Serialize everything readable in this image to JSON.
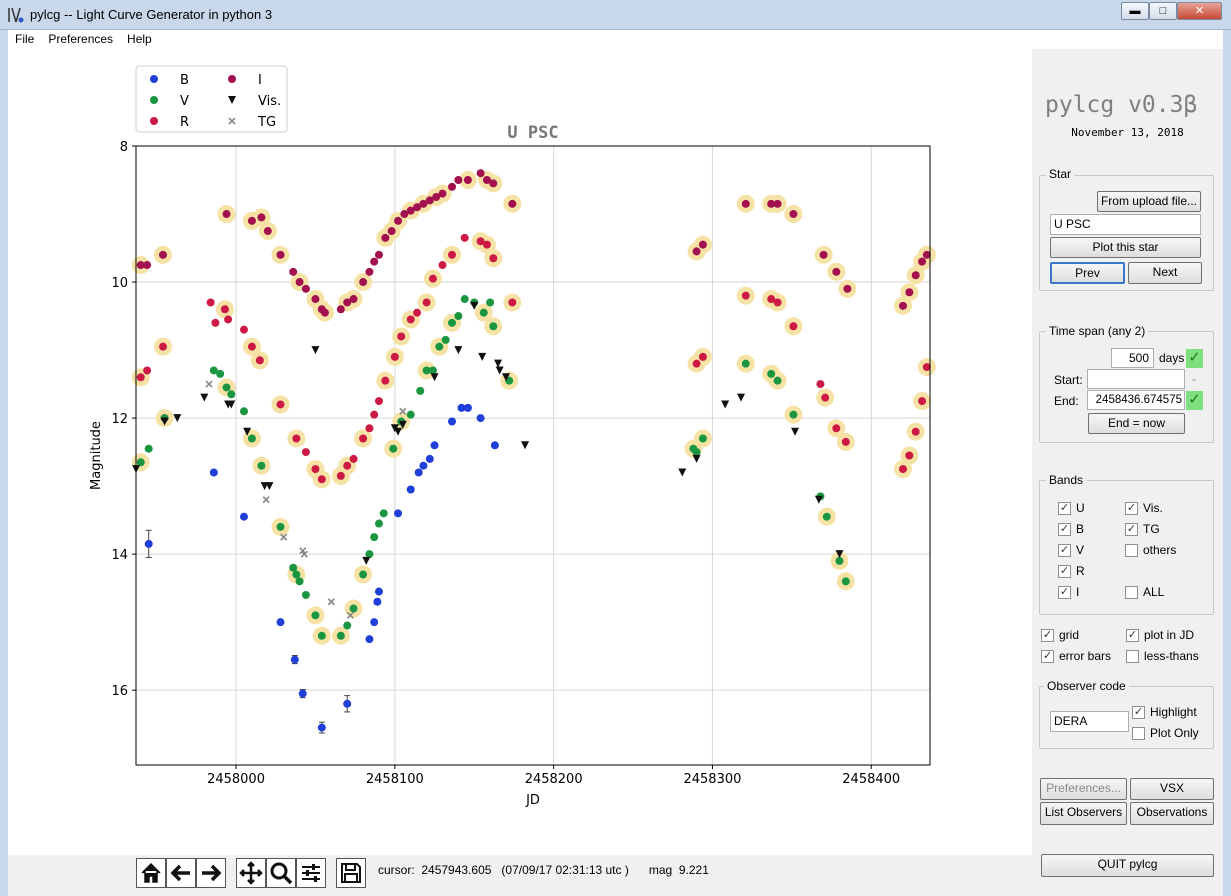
{
  "window": {
    "title": "pylcg  -- Light Curve Generator in python 3",
    "icon": "pylcg-app-icon",
    "minimize": "▬",
    "maximize": "□",
    "close": "✕"
  },
  "menu": [
    "File",
    "Preferences",
    "Help"
  ],
  "app": {
    "name": "pylcg v0.3β",
    "date": "November 13, 2018"
  },
  "star_panel": {
    "label": "Star",
    "upload_button": "From upload file...",
    "star_value": "U PSC",
    "plot_button": "Plot this star",
    "prev_button": "Prev",
    "next_button": "Next"
  },
  "timespan_panel": {
    "label": "Time span (any 2)",
    "days_value": "500",
    "days_label": "days",
    "start_label": "Start:",
    "start_value": "",
    "start_dash": "-",
    "end_label": "End:",
    "end_value": "2458436.674575",
    "end_now_button": "End = now",
    "ok_mark": "✓"
  },
  "bands_panel": {
    "label": "Bands",
    "left": [
      {
        "name": "U",
        "checked": true
      },
      {
        "name": "B",
        "checked": true
      },
      {
        "name": "V",
        "checked": true
      },
      {
        "name": "R",
        "checked": true
      },
      {
        "name": "I",
        "checked": true
      }
    ],
    "right": [
      {
        "name": "Vis.",
        "checked": true
      },
      {
        "name": "TG",
        "checked": true
      },
      {
        "name": "others",
        "checked": false
      },
      {
        "name": "ALL",
        "checked": false
      }
    ]
  },
  "options": {
    "grid": {
      "label": "grid",
      "checked": true
    },
    "plot_in_jd": {
      "label": "plot in JD",
      "checked": true
    },
    "error_bars": {
      "label": "error bars",
      "checked": true
    },
    "less_thans": {
      "label": "less-thans",
      "checked": false
    }
  },
  "observer_panel": {
    "label": "Observer code",
    "code": "DERA",
    "highlight": {
      "label": "Highlight",
      "checked": true
    },
    "plot_only": {
      "label": "Plot Only",
      "checked": false
    }
  },
  "bottom_buttons": {
    "preferences": "Preferences...",
    "vsx": "VSX",
    "list_observers": "List Observers",
    "observations": "Observations",
    "quit": "QUIT pylcg"
  },
  "status": {
    "cursor_text": "cursor:  2457943.605   (07/09/17 02:31:13 utc )      mag  9.221"
  },
  "toolbar_icons": [
    "home-icon",
    "back-arrow-icon",
    "forward-arrow-icon",
    "pan-icon",
    "zoom-icon",
    "configure-subplots-icon",
    "save-icon"
  ],
  "colors": {
    "B": "#1f3fd8",
    "V": "#1a9640",
    "R": "#cc1a44",
    "I": "#a3104f",
    "Vis.": "#111111",
    "TG": "#888888",
    "highlight": "#f7e2a6"
  },
  "chart_data": {
    "type": "scatter",
    "title": "U PSC",
    "xlabel": "JD",
    "ylabel": "Magnitude",
    "xlim": [
      2457937,
      2458437
    ],
    "ylim": [
      17.1,
      8.0
    ],
    "y_inverted": true,
    "grid": true,
    "legend_position": "top-left",
    "xticks": [
      2458000,
      2458100,
      2458200,
      2458300,
      2458400
    ],
    "yticks": [
      8,
      10,
      12,
      14,
      16
    ],
    "legend": [
      {
        "label": "B",
        "marker": "circle",
        "color": "#1f3fd8"
      },
      {
        "label": "V",
        "marker": "circle",
        "color": "#1a9640"
      },
      {
        "label": "R",
        "marker": "circle",
        "color": "#cc1a44"
      },
      {
        "label": "I",
        "marker": "circle",
        "color": "#a3104f"
      },
      {
        "label": "Vis.",
        "marker": "triangle-down",
        "color": "#111111"
      },
      {
        "label": "TG",
        "marker": "x",
        "color": "#888888"
      }
    ],
    "series": [
      {
        "name": "I",
        "marker": "circle",
        "color": "#a3104f",
        "x": [
          2457940,
          2457944,
          2457954,
          2457994,
          2458010,
          2458016,
          2458020,
          2458028,
          2458036,
          2458040,
          2458044,
          2458050,
          2458054,
          2458056,
          2458066,
          2458070,
          2458074,
          2458080,
          2458084,
          2458087,
          2458090,
          2458094,
          2458098,
          2458102,
          2458106,
          2458110,
          2458114,
          2458118,
          2458122,
          2458126,
          2458130,
          2458136,
          2458140,
          2458146,
          2458154,
          2458158,
          2458162,
          2458174,
          2458290,
          2458294,
          2458321,
          2458337,
          2458341,
          2458351,
          2458370,
          2458378,
          2458385,
          2458420,
          2458424,
          2458428,
          2458432,
          2458435
        ],
        "y": [
          9.75,
          9.75,
          9.6,
          9.0,
          9.1,
          9.05,
          9.25,
          9.6,
          9.85,
          10.0,
          10.1,
          10.25,
          10.4,
          10.45,
          10.4,
          10.3,
          10.25,
          10.0,
          9.85,
          9.7,
          9.6,
          9.35,
          9.25,
          9.1,
          9.0,
          8.95,
          8.9,
          8.85,
          8.8,
          8.75,
          8.7,
          8.6,
          8.5,
          8.5,
          8.4,
          8.5,
          8.55,
          8.85,
          9.55,
          9.45,
          8.85,
          8.85,
          8.85,
          9.0,
          9.6,
          9.85,
          10.1,
          10.35,
          10.15,
          9.9,
          9.7,
          9.6
        ],
        "highlight": [
          1,
          0,
          1,
          1,
          1,
          1,
          1,
          1,
          0,
          1,
          0,
          1,
          1,
          1,
          0,
          1,
          1,
          1,
          0,
          0,
          0,
          1,
          1,
          1,
          0,
          1,
          0,
          1,
          0,
          1,
          1,
          0,
          0,
          1,
          0,
          1,
          1,
          1,
          1,
          1,
          1,
          1,
          1,
          1,
          1,
          1,
          1,
          1,
          1,
          1,
          1,
          1
        ]
      },
      {
        "name": "R",
        "marker": "circle",
        "color": "#cc1a44",
        "x": [
          2457940,
          2457944,
          2457954,
          2457955,
          2457984,
          2457987,
          2457993,
          2457995,
          2458005,
          2458010,
          2458015,
          2458028,
          2458038,
          2458044,
          2458050,
          2458054,
          2458066,
          2458070,
          2458074,
          2458080,
          2458084,
          2458087,
          2458090,
          2458094,
          2458100,
          2458104,
          2458110,
          2458114,
          2458120,
          2458124,
          2458130,
          2458136,
          2458144,
          2458154,
          2458158,
          2458162,
          2458174,
          2458290,
          2458294,
          2458321,
          2458337,
          2458341,
          2458351,
          2458368,
          2458371,
          2458378,
          2458384,
          2458420,
          2458424,
          2458428,
          2458432,
          2458435
        ],
        "y": [
          11.4,
          11.3,
          10.95,
          12.0,
          10.3,
          10.6,
          10.4,
          10.55,
          10.7,
          10.95,
          11.15,
          11.8,
          12.3,
          12.5,
          12.75,
          12.9,
          12.85,
          12.7,
          12.6,
          12.3,
          12.15,
          11.95,
          11.75,
          11.45,
          11.1,
          10.8,
          10.55,
          10.45,
          10.3,
          9.95,
          9.75,
          9.6,
          9.35,
          9.4,
          9.45,
          9.65,
          10.3,
          11.2,
          11.1,
          10.2,
          10.25,
          10.3,
          10.65,
          11.5,
          11.7,
          12.15,
          12.35,
          12.75,
          12.55,
          12.2,
          11.75,
          11.25
        ],
        "highlight": [
          1,
          0,
          1,
          0,
          0,
          0,
          1,
          0,
          0,
          1,
          1,
          1,
          1,
          0,
          1,
          1,
          1,
          1,
          0,
          1,
          0,
          0,
          0,
          1,
          1,
          1,
          1,
          0,
          1,
          1,
          0,
          1,
          0,
          1,
          1,
          1,
          1,
          1,
          1,
          1,
          1,
          1,
          1,
          0,
          1,
          1,
          1,
          1,
          1,
          1,
          1,
          1
        ]
      },
      {
        "name": "V",
        "marker": "circle",
        "color": "#1a9640",
        "x": [
          2457940,
          2457945,
          2457955,
          2457986,
          2457990,
          2457994,
          2457997,
          2458005,
          2458010,
          2458016,
          2458028,
          2458036,
          2458038,
          2458040,
          2458044,
          2458050,
          2458054,
          2458066,
          2458070,
          2458074,
          2458080,
          2458084,
          2458087,
          2458090,
          2458093,
          2458099,
          2458104,
          2458110,
          2458116,
          2458120,
          2458124,
          2458128,
          2458132,
          2458136,
          2458140,
          2458144,
          2458150,
          2458156,
          2458160,
          2458162,
          2458172,
          2458288,
          2458290,
          2458294,
          2458321,
          2458337,
          2458341,
          2458351,
          2458368,
          2458372,
          2458380,
          2458384
        ],
        "y": [
          12.65,
          12.45,
          12.0,
          11.3,
          11.35,
          11.55,
          11.65,
          11.9,
          12.3,
          12.7,
          13.6,
          14.2,
          14.3,
          14.4,
          14.6,
          14.9,
          15.2,
          15.2,
          15.05,
          14.8,
          14.3,
          14.0,
          13.75,
          13.55,
          13.4,
          12.45,
          12.05,
          11.95,
          11.6,
          11.3,
          11.3,
          10.95,
          10.85,
          10.6,
          10.5,
          10.25,
          10.3,
          10.45,
          10.3,
          10.65,
          11.45,
          12.45,
          12.5,
          12.3,
          11.2,
          11.35,
          11.45,
          11.95,
          13.15,
          13.45,
          14.1,
          14.4
        ],
        "highlight": [
          1,
          0,
          1,
          0,
          0,
          1,
          0,
          0,
          1,
          1,
          1,
          0,
          1,
          0,
          0,
          1,
          1,
          1,
          0,
          1,
          1,
          0,
          0,
          0,
          0,
          1,
          1,
          0,
          0,
          1,
          0,
          1,
          0,
          1,
          0,
          0,
          0,
          1,
          0,
          1,
          1,
          1,
          0,
          1,
          1,
          1,
          1,
          1,
          0,
          1,
          1,
          1
        ]
      },
      {
        "name": "B",
        "marker": "circle",
        "color": "#1f3fd8",
        "x": [
          2457945,
          2457986,
          2458005,
          2458028,
          2458037,
          2458042,
          2458054,
          2458070,
          2458084,
          2458087,
          2458089,
          2458090,
          2458102,
          2458110,
          2458115,
          2458118,
          2458122,
          2458125,
          2458136,
          2458142,
          2458146,
          2458154,
          2458163
        ],
        "y": [
          13.85,
          12.8,
          13.45,
          15.0,
          15.55,
          16.05,
          16.55,
          16.2,
          15.25,
          15.0,
          14.7,
          14.55,
          13.4,
          13.05,
          12.8,
          12.7,
          12.6,
          12.4,
          12.05,
          11.85,
          11.85,
          12.0,
          12.4
        ],
        "yerr": [
          0.2,
          0,
          0,
          0,
          0.06,
          0.06,
          0.08,
          0.12,
          0,
          0,
          0,
          0,
          0,
          0,
          0,
          0,
          0,
          0,
          0,
          0,
          0,
          0,
          0
        ],
        "highlight": []
      },
      {
        "name": "Vis.",
        "marker": "triangle-down",
        "color": "#111111",
        "x": [
          2457937,
          2457955,
          2457963,
          2457980,
          2457995,
          2457997,
          2458007,
          2458018,
          2458021,
          2458050,
          2458082,
          2458100,
          2458102,
          2458105,
          2458125,
          2458140,
          2458150,
          2458155,
          2458165,
          2458166,
          2458170,
          2458182,
          2458281,
          2458290,
          2458308,
          2458318,
          2458352,
          2458367,
          2458380
        ],
        "y": [
          12.75,
          12.05,
          12.0,
          11.7,
          11.8,
          11.8,
          12.2,
          13.0,
          13.0,
          11.0,
          14.1,
          12.15,
          12.2,
          12.1,
          11.4,
          11.0,
          10.35,
          11.1,
          11.2,
          11.3,
          11.4,
          12.4,
          12.8,
          12.6,
          11.8,
          11.7,
          12.2,
          13.2,
          14.0
        ],
        "highlight": []
      },
      {
        "name": "TG",
        "marker": "x",
        "color": "#888888",
        "x": [
          2457983,
          2458030,
          2458019,
          2458042,
          2458043,
          2458060,
          2458072,
          2458105
        ],
        "y": [
          11.5,
          13.75,
          13.2,
          13.95,
          14.0,
          14.7,
          14.9,
          11.9
        ],
        "highlight": []
      }
    ]
  }
}
